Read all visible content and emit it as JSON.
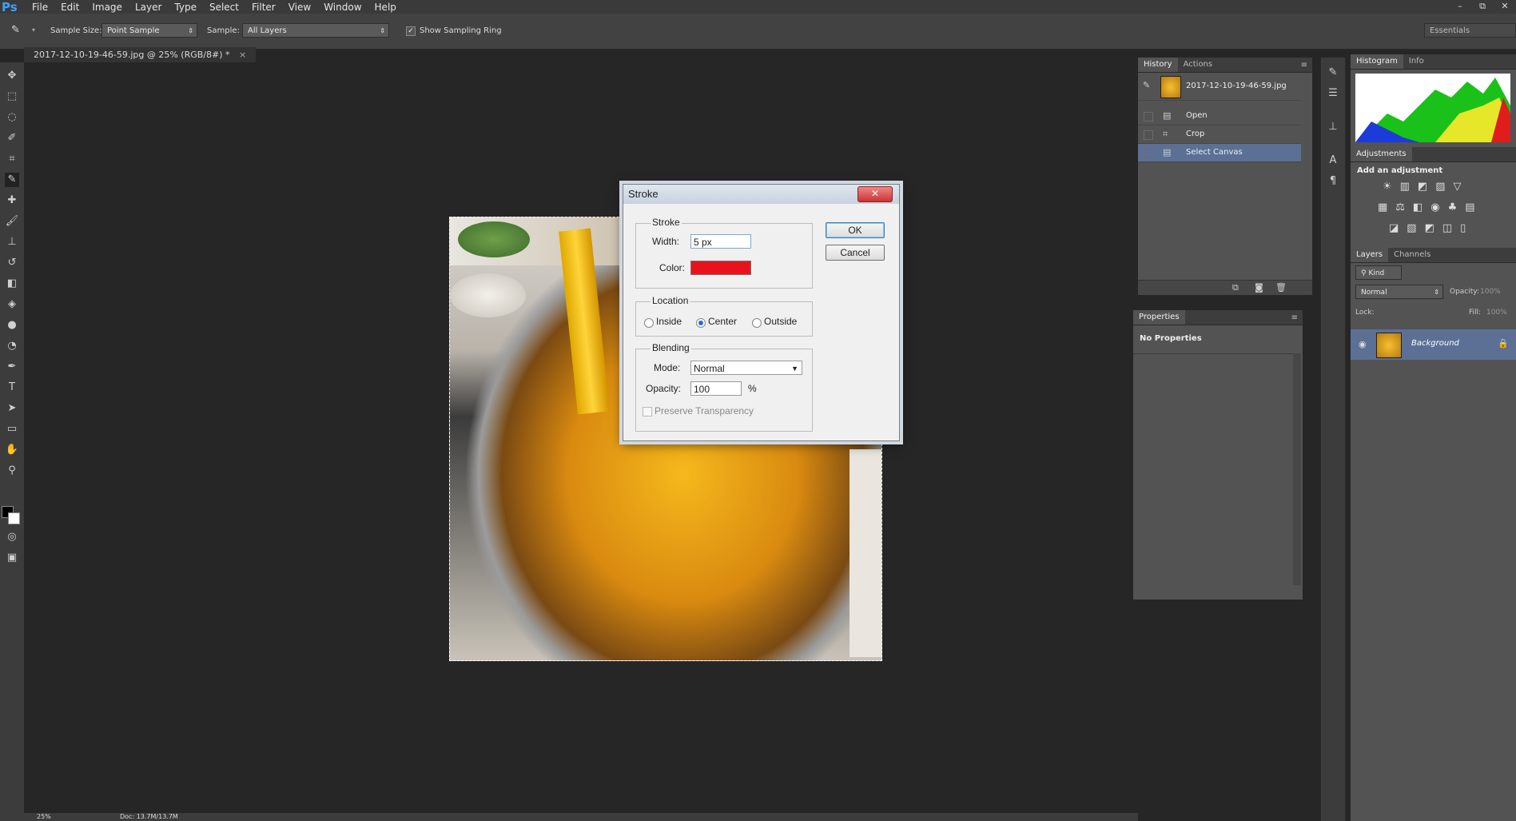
{
  "app": {
    "logo": "Ps"
  },
  "menu": [
    "File",
    "Edit",
    "Image",
    "Layer",
    "Type",
    "Select",
    "Filter",
    "View",
    "Window",
    "Help"
  ],
  "window_controls": [
    "–",
    "⧉",
    "✕"
  ],
  "options": {
    "sample_size_label": "Sample Size:",
    "sample_size_value": "Point Sample",
    "sample_label": "Sample:",
    "sample_value": "All Layers",
    "show_ring_label": "Show Sampling Ring",
    "workspace": "Essentials"
  },
  "document": {
    "tab_title": "2017-12-10-19-46-59.jpg @ 25% (RGB/8#) *",
    "tab_close": "×",
    "zoom": "25%",
    "doc_info": "Doc: 13.7M/13.7M"
  },
  "history_panel": {
    "tabs": [
      "History",
      "Actions"
    ],
    "snapshot": "2017-12-10-19-46-59.jpg",
    "items": [
      "Open",
      "Crop",
      "Select Canvas"
    ]
  },
  "properties_panel": {
    "title": "Properties",
    "message": "No Properties"
  },
  "histogram_panel": {
    "tabs": [
      "Histogram",
      "Info"
    ]
  },
  "adjustments_panel": {
    "title": "Adjustments",
    "subtitle": "Add an adjustment"
  },
  "layers_panel": {
    "tabs": [
      "Layers",
      "Channels"
    ],
    "kind": "Kind",
    "blend_mode": "Normal",
    "opacity_label": "Opacity:",
    "opacity_value": "100%",
    "lock_label": "Lock:",
    "fill_label": "Fill:",
    "fill_value": "100%",
    "layer_name": "Background"
  },
  "stroke_dialog": {
    "title": "Stroke",
    "stroke_group": "Stroke",
    "width_label": "Width:",
    "width_value": "5 px",
    "color_label": "Color:",
    "color_value": "#e8121c",
    "location_group": "Location",
    "location_options": [
      "Inside",
      "Center",
      "Outside"
    ],
    "location_selected": "Center",
    "blending_group": "Blending",
    "mode_label": "Mode:",
    "mode_value": "Normal",
    "opacity_label": "Opacity:",
    "opacity_value": "100",
    "opacity_unit": "%",
    "preserve_label": "Preserve Transparency",
    "ok": "OK",
    "cancel": "Cancel"
  }
}
